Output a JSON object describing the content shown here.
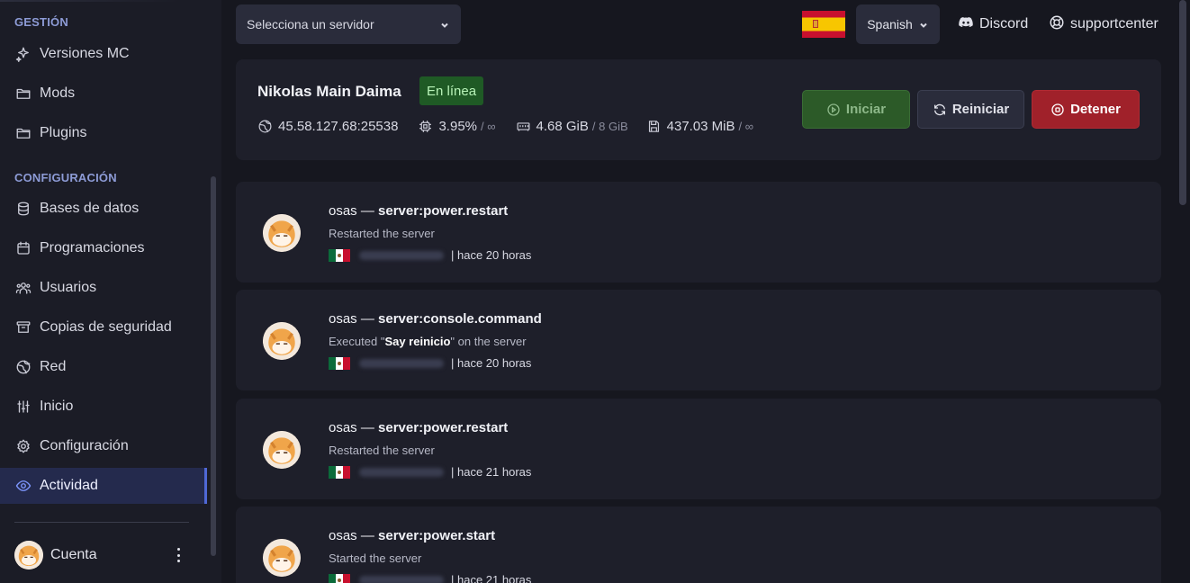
{
  "sidebar": {
    "sections": {
      "management": "GESTIÓN",
      "configuration": "CONFIGURACIÓN"
    },
    "items": [
      {
        "label": "Versiones MC",
        "icon": "sparkles-icon"
      },
      {
        "label": "Mods",
        "icon": "folder-icon"
      },
      {
        "label": "Plugins",
        "icon": "folder-icon"
      },
      {
        "label": "Bases de datos",
        "icon": "database-icon"
      },
      {
        "label": "Programaciones",
        "icon": "calendar-icon"
      },
      {
        "label": "Usuarios",
        "icon": "users-icon"
      },
      {
        "label": "Copias de seguridad",
        "icon": "archive-icon"
      },
      {
        "label": "Red",
        "icon": "globe-icon"
      },
      {
        "label": "Inicio",
        "icon": "sliders-icon"
      },
      {
        "label": "Configuración",
        "icon": "gear-icon"
      },
      {
        "label": "Actividad",
        "icon": "eye-icon",
        "active": true
      }
    ],
    "account": {
      "label": "Cuenta"
    }
  },
  "topbar": {
    "server_select_placeholder": "Selecciona un servidor",
    "language": "Spanish",
    "discord": "Discord",
    "support": "supportcenter"
  },
  "server": {
    "name": "Nikolas Main Daima",
    "status": "En línea",
    "address": "45.58.127.68:25538",
    "cpu": "3.95%",
    "cpu_limit": "/ ∞",
    "memory": "4.68 GiB",
    "memory_limit": "/ 8 GiB",
    "disk": "437.03 MiB",
    "disk_limit": "/ ∞",
    "buttons": {
      "start": "Iniciar",
      "restart": "Reiniciar",
      "stop": "Detener"
    }
  },
  "activity": [
    {
      "user": "osas",
      "sep": "—",
      "event": "server:power.restart",
      "desc_pre": "Restarted the server",
      "desc_bold": "",
      "desc_post": "",
      "time": "| hace 20 horas"
    },
    {
      "user": "osas",
      "sep": "—",
      "event": "server:console.command",
      "desc_pre": "Executed \"",
      "desc_bold": "Say reinicio",
      "desc_post": "\" on the server",
      "time": "| hace 20 horas"
    },
    {
      "user": "osas",
      "sep": "—",
      "event": "server:power.restart",
      "desc_pre": "Restarted the server",
      "desc_bold": "",
      "desc_post": "",
      "time": "| hace 21 horas"
    },
    {
      "user": "osas",
      "sep": "—",
      "event": "server:power.start",
      "desc_pre": "Started the server",
      "desc_bold": "",
      "desc_post": "",
      "time": "| hace 21 horas"
    }
  ],
  "colors": {
    "accent": "#4f68d6",
    "online": "#1f5a25",
    "start": "#2c5a28",
    "stop": "#a0212a"
  }
}
